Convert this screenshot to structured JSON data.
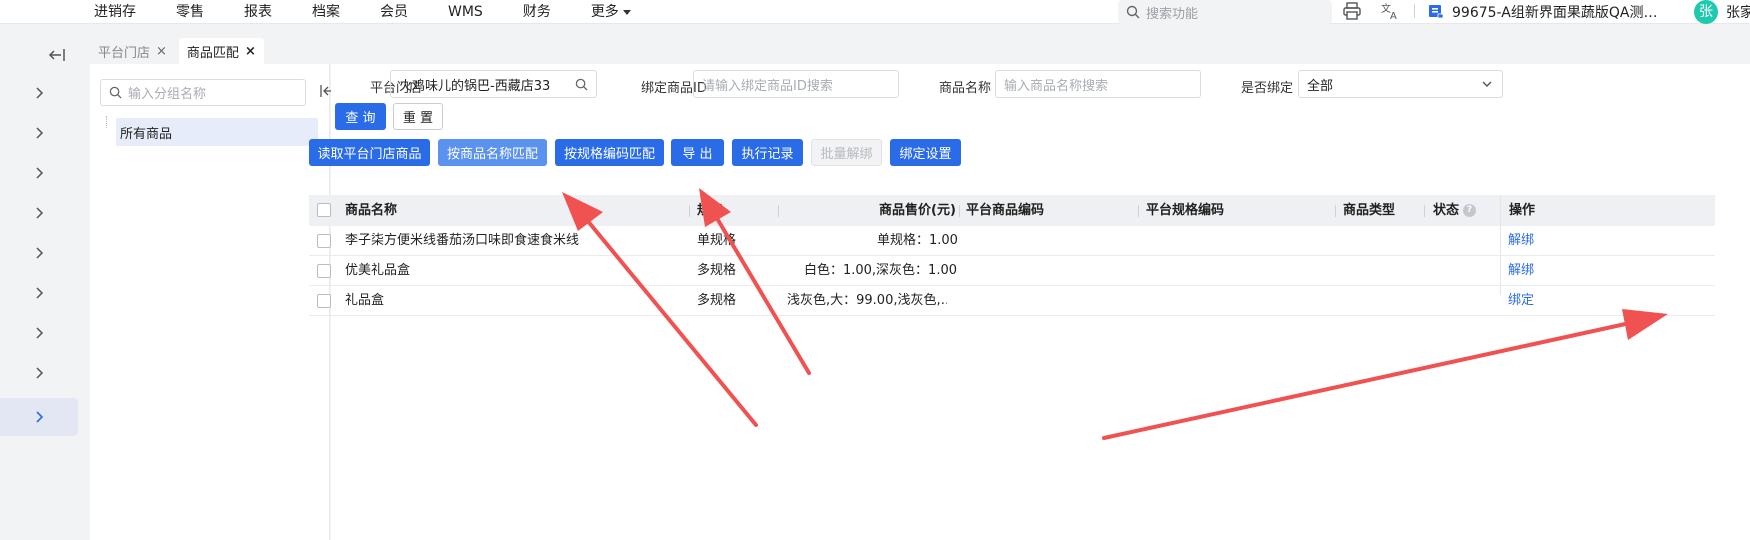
{
  "topbar": {
    "nav": [
      "进销存",
      "零售",
      "报表",
      "档案",
      "会员",
      "WMS",
      "财务",
      "更多"
    ],
    "search_placeholder": "搜索功能",
    "store_name": "99675-A组新界面果蔬版QA测…",
    "avatar_text": "张",
    "username": "张家"
  },
  "tabs": [
    {
      "label": "平台门店",
      "close": "×"
    },
    {
      "label": "商品匹配",
      "close": "×"
    }
  ],
  "category": {
    "search_placeholder": "输入分组名称",
    "items": [
      "所有商品"
    ]
  },
  "filters": {
    "store_label": "平台门店",
    "store_value": "火鸡味儿的锅巴-西藏店33",
    "bind_id_label": "绑定商品ID",
    "bind_id_placeholder": "请输入绑定商品ID搜索",
    "name_label": "商品名称",
    "name_placeholder": "输入商品名称搜索",
    "bound_label": "是否绑定",
    "bound_value": "全部",
    "query_button": "查 询",
    "reset_button": "重 置"
  },
  "toolbar": {
    "read_store_goods": "读取平台门店商品",
    "match_by_name": "按商品名称匹配",
    "match_by_spec_code": "按规格编码匹配",
    "export": "导 出",
    "exec_log": "执行记录",
    "batch_unbind": "批量解绑",
    "bind_settings": "绑定设置"
  },
  "table": {
    "columns": [
      "商品名称",
      "规格",
      "商品售价(元)",
      "平台商品编码",
      "平台规格编码",
      "商品类型",
      "状态",
      "操作"
    ],
    "help_glyph": "?",
    "rows": [
      {
        "name": "李子柒方便米线番茄汤口味即食速食米线",
        "spec": "单规格",
        "price": "单规格：1.00",
        "platform_code": "",
        "spec_code": "",
        "type": "",
        "status": "",
        "action": "解绑"
      },
      {
        "name": "优美礼品盒",
        "spec": "多规格",
        "price": "白色：1.00,深灰色：1.00",
        "platform_code": "",
        "spec_code": "",
        "type": "",
        "status": "",
        "action": "解绑"
      },
      {
        "name": "礼品盒",
        "spec": "多规格",
        "price": "浅灰色,大：99.00,浅灰色,…",
        "platform_code": "",
        "spec_code": "",
        "type": "",
        "status": "",
        "action": "绑定"
      }
    ]
  },
  "colors": {
    "primary": "#2a6be8",
    "primary_light": "#5b91ef",
    "annotation_arrow": "#f05252",
    "avatar": "#1fc9b0"
  }
}
